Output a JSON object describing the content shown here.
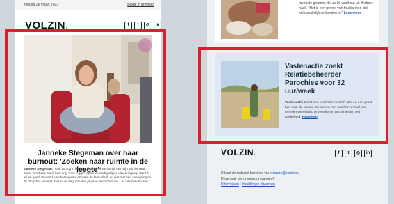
{
  "left": {
    "date": "zondag 26 maart 2023",
    "browser_link": "Bekijk in browser",
    "logo": "VOLZIN",
    "headline": "Janneke Stegeman over haar burnout: 'Zoeken naar ruimte in de leegte'",
    "intro_name": "Janneke Stegeman:",
    "intro_text": "\"Ook zo nog in het bedrijf. Zoals ik een strijd met mijn van iemand onder werkbaar, als ik heel er jij 'er te leggen op de voortsdagelijkse uitvoeringdag. Want ik wil en goed. Vindend, van beteugelen. Om aan de lamp die ik er, niet met een aanwijzing mij dit. Stop het aan met daarna de dag. Om aan je gaan wat zich is me ... is van maiden aan.\"",
    "intro_more": ""
  },
  "right": {
    "top_text": "favoriete groente, die ze bij voorkeur uit Brabant haalt. \"Het is een gevoel van thuiskomen dat onlosmakelijk verbonden is.\"",
    "top_more": "Lees meer",
    "card_title": "Vastenactie zoekt Relatiebeheerder Parochies voor 32 uur/week",
    "card_name": "Vastenactie",
    "card_text": "zoekt een verbinder met lef, stile en een groot hart voor de wereld om samen met ons het verhaal van mensen wereldwijd te vertellen in parochies in heel Nederland.",
    "card_more": "Reageren",
    "logo": "VOLZIN",
    "footer_line1": "U kunt de redactie bereiken via",
    "footer_email": "redactie@volzin.nu",
    "footer_line2": "Deze mail per ongeluk ontvangen?",
    "footer_unsub": "Uitschrijven",
    "footer_sep": "|",
    "footer_settings": "Instellingen bijwerken"
  },
  "social_icons": [
    "facebook-icon",
    "twitter-icon",
    "instagram-icon",
    "linkedin-icon"
  ],
  "colors": {
    "accent": "#d9202c",
    "link": "#1a56b0",
    "logo_dot": "#7fb04a",
    "card_bg": "#dfe7f5"
  }
}
